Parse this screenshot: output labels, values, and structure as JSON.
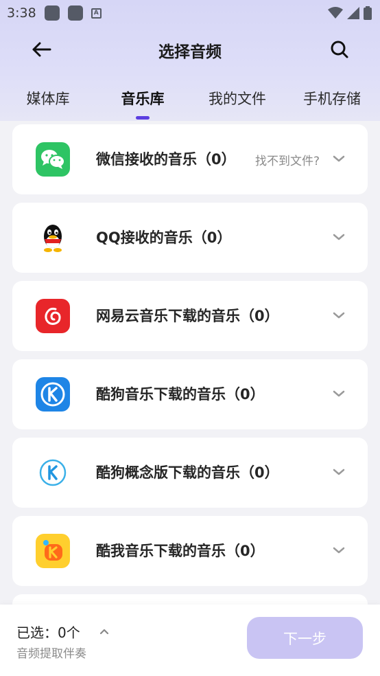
{
  "status_bar": {
    "time": "3:38"
  },
  "header": {
    "title": "选择音频",
    "back_icon": "arrow-left-icon",
    "search_icon": "search-icon"
  },
  "tabs": [
    {
      "label": "媒体库",
      "active": false
    },
    {
      "label": "音乐库",
      "active": true
    },
    {
      "label": "我的文件",
      "active": false
    },
    {
      "label": "手机存储",
      "active": false
    }
  ],
  "accent_color": "#5b3ee0",
  "sources": [
    {
      "label": "微信接收的音乐（0）",
      "icon": "wechat-icon",
      "help": "找不到文件?"
    },
    {
      "label": "QQ接收的音乐（0）",
      "icon": "qq-icon"
    },
    {
      "label": "网易云音乐下载的音乐（0）",
      "icon": "netease-music-icon"
    },
    {
      "label": "酷狗音乐下载的音乐（0）",
      "icon": "kugou-icon"
    },
    {
      "label": "酷狗概念版下载的音乐（0）",
      "icon": "kugou-concept-icon"
    },
    {
      "label": "酷我音乐下载的音乐（0）",
      "icon": "kuwo-icon"
    }
  ],
  "footer": {
    "selected": "已选：0个",
    "extract": "音频提取伴奏",
    "next": "下一步"
  }
}
